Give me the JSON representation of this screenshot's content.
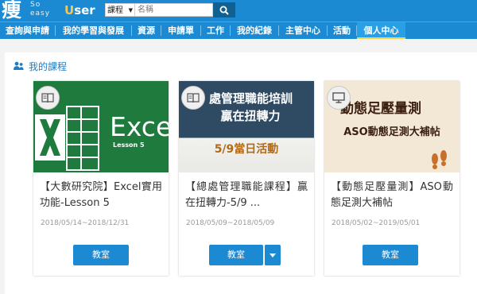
{
  "header": {
    "logo_main": "痩",
    "logo_sub_1": "So",
    "logo_sub_2": "easy",
    "logo_user_u": "U",
    "logo_user_rest": "ser",
    "search_select": "課程",
    "search_placeholder": "名稱",
    "search_icon": "magnifier-icon"
  },
  "nav": {
    "items": [
      {
        "label": "查詢與申請"
      },
      {
        "label": "我的學習與發展"
      },
      {
        "label": "資源"
      },
      {
        "label": "申請單"
      },
      {
        "label": "工作"
      },
      {
        "label": "我的紀錄"
      },
      {
        "label": "主管中心"
      },
      {
        "label": "活動"
      },
      {
        "label": "個人中心",
        "active": true
      }
    ]
  },
  "section": {
    "title": "我的課程",
    "icon": "users-icon"
  },
  "courses": [
    {
      "thumb_word": "Excel",
      "thumb_sub": "Lesson 5",
      "badge_icon": "book-icon",
      "title": "【大數研究院】Excel實用功能-Lesson 5",
      "date": "2018/05/14~2018/12/31",
      "button": "教室"
    },
    {
      "thumb_line1": "處管理職能培訓",
      "thumb_line2": "贏在扭轉力",
      "thumb_line3": "5/9當日活動",
      "badge_icon": "book-icon",
      "title": "【總處管理職能課程】贏在扭轉力-5/9 ...",
      "date": "2018/05/09~2018/05/09",
      "button": "教室",
      "has_dropdown": true
    },
    {
      "thumb_line1": "動態足壓量測",
      "thumb_line2": "ASO動態足測大補帖",
      "badge_icon": "monitor-icon",
      "title": "【動態足壓量測】ASO動態足測大補帖",
      "date": "2018/05/02~2019/05/01",
      "button": "教室"
    }
  ],
  "colors": {
    "brand": "#1b8ad3",
    "accent_yellow": "#f6d14a",
    "excel_green": "#1f7a3e",
    "title_blue": "#1b7dc6"
  }
}
